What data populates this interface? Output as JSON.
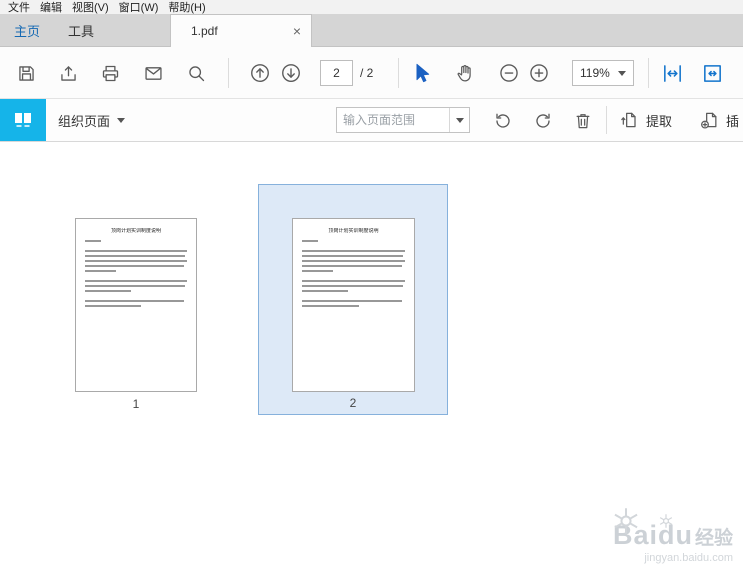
{
  "menu": {
    "items": [
      "文件",
      "编辑",
      "视图(V)",
      "窗口(W)",
      "帮助(H)"
    ]
  },
  "tabs": {
    "home": "主页",
    "tools": "工具",
    "document": "1.pdf",
    "close_glyph": "×"
  },
  "toolbar": {
    "page_current": "2",
    "page_total": "/ 2",
    "zoom": "119%",
    "icons": [
      "save-icon",
      "share-icon",
      "print-icon",
      "email-icon",
      "search-icon",
      "page-up-icon",
      "page-down-icon",
      "select-tool-icon",
      "hand-tool-icon",
      "zoom-out-icon",
      "zoom-in-icon",
      "fit-width-icon",
      "fit-page-icon"
    ]
  },
  "organize": {
    "title": "组织页面",
    "range_placeholder": "输入页面范围",
    "extract_label": "提取",
    "insert_label": "插",
    "icons": [
      "organize-pages-icon",
      "rotate-ccw-icon",
      "rotate-cw-icon",
      "delete-icon",
      "extract-icon",
      "insert-icon"
    ]
  },
  "thumbnails": {
    "doc_title": "顶岗计划实训制度说明",
    "line_widths": [
      0.16,
      0,
      1,
      0.98,
      1,
      0.97,
      0.3,
      0,
      1,
      0.98,
      0.45,
      0,
      0.97,
      0.55
    ],
    "pages": [
      {
        "label": "1",
        "selected": false
      },
      {
        "label": "2",
        "selected": true
      }
    ]
  },
  "watermark": {
    "brand": "Baidu",
    "suffix": "经验",
    "url": "jingyan.baidu.com"
  },
  "colors": {
    "accent_blue": "#1b61c2",
    "brand_cyan": "#15b4e9",
    "selection_bg": "#dde9f7",
    "selection_border": "#86b1dc"
  }
}
